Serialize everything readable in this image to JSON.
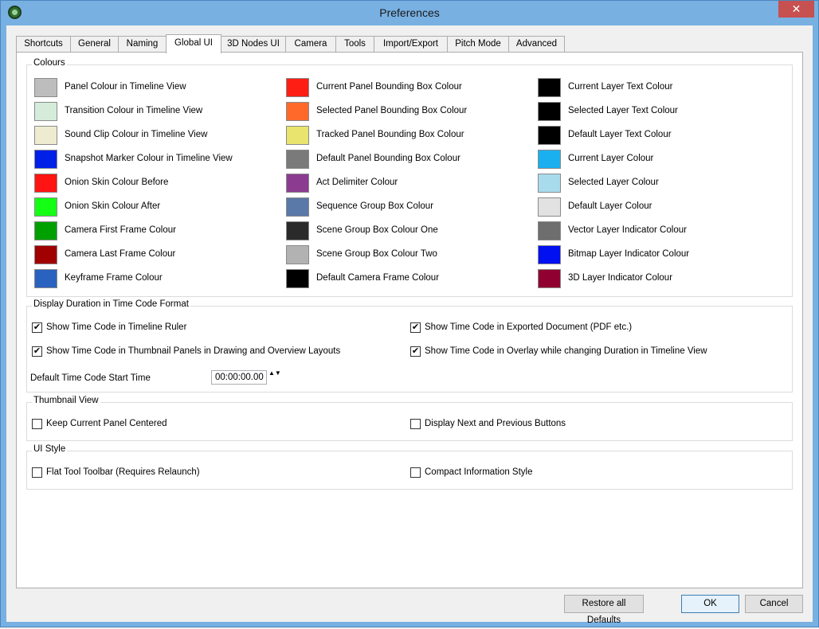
{
  "window": {
    "title": "Preferences",
    "close_glyph": "✕",
    "app_icon": "storyboard-app-icon"
  },
  "tabs": [
    {
      "label": "Shortcuts"
    },
    {
      "label": "General"
    },
    {
      "label": "Naming"
    },
    {
      "label": "Global UI"
    },
    {
      "label": "3D Nodes UI"
    },
    {
      "label": "Camera"
    },
    {
      "label": "Tools"
    },
    {
      "label": "Import/Export"
    },
    {
      "label": "Pitch Mode"
    },
    {
      "label": "Advanced"
    }
  ],
  "active_tab": "Global UI",
  "colours": {
    "title": "Colours",
    "items": [
      {
        "label": "Panel Colour in Timeline View",
        "color": "#bdbdbd"
      },
      {
        "label": "Transition Colour in Timeline View",
        "color": "#d4ecd9"
      },
      {
        "label": "Sound Clip Colour in Timeline View",
        "color": "#eeebd0"
      },
      {
        "label": "Snapshot Marker Colour in Timeline View",
        "color": "#0020e8"
      },
      {
        "label": "Onion Skin Colour Before",
        "color": "#ff1414"
      },
      {
        "label": "Onion Skin Colour After",
        "color": "#14ff14"
      },
      {
        "label": "Camera First Frame Colour",
        "color": "#00a000"
      },
      {
        "label": "Camera Last Frame Colour",
        "color": "#a00000"
      },
      {
        "label": "Keyframe Frame Colour",
        "color": "#2a62c0"
      },
      {
        "label": "Current Panel Bounding Box Colour",
        "color": "#ff1e14"
      },
      {
        "label": "Selected Panel Bounding Box Colour",
        "color": "#ff6a2a"
      },
      {
        "label": "Tracked Panel Bounding Box Colour",
        "color": "#e8e46e"
      },
      {
        "label": "Default Panel Bounding Box Colour",
        "color": "#7a7a7a"
      },
      {
        "label": "Act Delimiter Colour",
        "color": "#8c3c90"
      },
      {
        "label": "Sequence Group Box Colour",
        "color": "#5a78a8"
      },
      {
        "label": "Scene Group Box Colour One",
        "color": "#2a2a2a"
      },
      {
        "label": "Scene Group Box Colour Two",
        "color": "#b2b2b2"
      },
      {
        "label": "Default Camera Frame Colour",
        "color": "#000000"
      },
      {
        "label": "Current Layer Text Colour",
        "color": "#000000"
      },
      {
        "label": "Selected Layer Text Colour",
        "color": "#000000"
      },
      {
        "label": "Default Layer Text Colour",
        "color": "#000000"
      },
      {
        "label": "Current Layer Colour",
        "color": "#1ab0f0"
      },
      {
        "label": "Selected Layer Colour",
        "color": "#a8dcec"
      },
      {
        "label": "Default Layer Colour",
        "color": "#e2e2e2"
      },
      {
        "label": "Vector Layer Indicator Colour",
        "color": "#6e6e6e"
      },
      {
        "label": "Bitmap Layer Indicator Colour",
        "color": "#0010f0"
      },
      {
        "label": "3D Layer Indicator Colour",
        "color": "#900030"
      }
    ]
  },
  "display_duration": {
    "title": "Display Duration in Time Code Format",
    "checks": [
      {
        "label": "Show Time Code in Timeline Ruler",
        "checked": true
      },
      {
        "label": "Show Time Code in Exported Document (PDF etc.)",
        "checked": true
      },
      {
        "label": "Show Time Code in Thumbnail Panels in Drawing and Overview Layouts",
        "checked": true
      },
      {
        "label": "Show Time Code in Overlay while changing Duration in Timeline View",
        "checked": true
      }
    ],
    "start_time_label": "Default Time Code Start Time",
    "start_time_value": "00:00:00.00",
    "spin_glyph": "▲▼"
  },
  "thumbnail_view": {
    "title": "Thumbnail View",
    "checks": [
      {
        "label": "Keep Current Panel Centered",
        "checked": false
      },
      {
        "label": "Display Next and Previous Buttons",
        "checked": false
      }
    ]
  },
  "ui_style": {
    "title": "UI Style",
    "checks": [
      {
        "label": "Flat Tool Toolbar (Requires Relaunch)",
        "checked": false
      },
      {
        "label": "Compact Information Style",
        "checked": false
      }
    ]
  },
  "buttons": {
    "restore": "Restore all Defaults",
    "ok": "OK",
    "cancel": "Cancel"
  },
  "check_glyph": "✔"
}
